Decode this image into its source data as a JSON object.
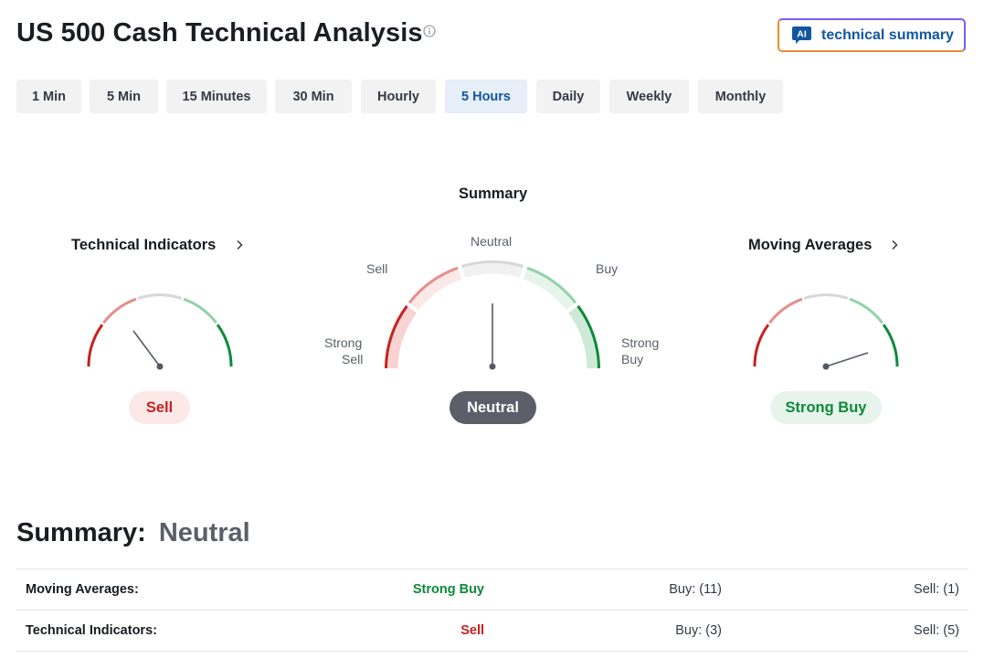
{
  "page": {
    "title": "US 500 Cash Technical Analysis"
  },
  "ai_button": {
    "badge": "AI",
    "label": "technical summary"
  },
  "timeframes": {
    "selected": "5 Hours",
    "items": [
      "1 Min",
      "5 Min",
      "15 Minutes",
      "30 Min",
      "Hourly",
      "5 Hours",
      "Daily",
      "Weekly",
      "Monthly"
    ]
  },
  "gauges": {
    "summary": {
      "title": "Summary",
      "labels": {
        "strong_sell_1": "Strong",
        "strong_sell_2": "Sell",
        "sell": "Sell",
        "neutral": "Neutral",
        "buy": "Buy",
        "strong_buy_1": "Strong",
        "strong_buy_2": "Buy"
      },
      "value": "Neutral"
    },
    "technical_indicators": {
      "title": "Technical Indicators",
      "value": "Sell"
    },
    "moving_averages": {
      "title": "Moving Averages",
      "value": "Strong Buy"
    }
  },
  "summary": {
    "label": "Summary:",
    "value": "Neutral",
    "rows": [
      {
        "label": "Moving Averages:",
        "signal": "Strong Buy",
        "buy": "Buy: (11)",
        "sell": "Sell: (1)"
      },
      {
        "label": "Technical Indicators:",
        "signal": "Sell",
        "buy": "Buy: (3)",
        "sell": "Sell: (5)"
      }
    ]
  },
  "colors": {
    "strong_sell": "#c5221f",
    "sell": "#e48f8c",
    "neutral": "#d6d7d9",
    "buy": "#92d2aa",
    "strong_buy": "#0d8a3a",
    "accent": "#1256a0"
  },
  "icons": {
    "info": "info-icon",
    "chevron": "chevron-right-icon",
    "ai": "ai-chat-icon"
  }
}
